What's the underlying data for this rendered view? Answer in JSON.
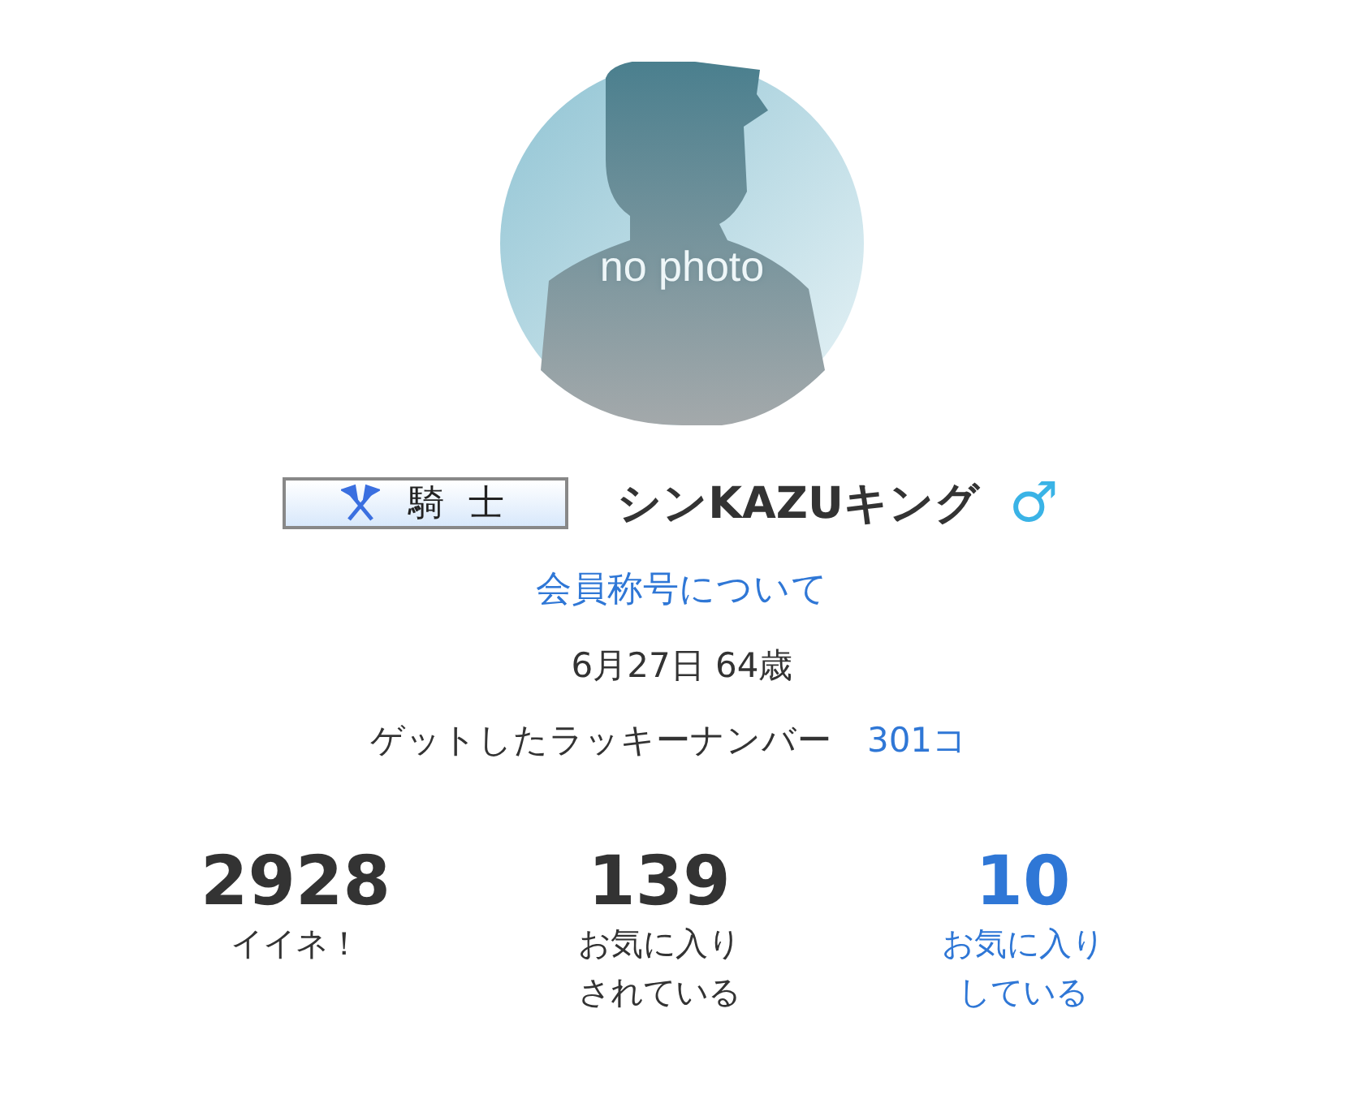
{
  "avatar": {
    "caption": "no photo"
  },
  "title_badge": {
    "label": "騎 士"
  },
  "user": {
    "name": "シンKAZUキング",
    "gender_symbol": "♂"
  },
  "title_link": "会員称号について",
  "birthday": "6月27日 64歳",
  "lucky_number": {
    "label": "ゲットしたラッキーナンバー",
    "count": "301コ"
  },
  "stats": [
    {
      "value": "2928",
      "label_lines": [
        "イイネ！"
      ],
      "link": false
    },
    {
      "value": "139",
      "label_lines": [
        "お気に入り",
        "されている"
      ],
      "link": false
    },
    {
      "value": "10",
      "label_lines": [
        "お気に入り",
        "している"
      ],
      "link": true
    }
  ]
}
